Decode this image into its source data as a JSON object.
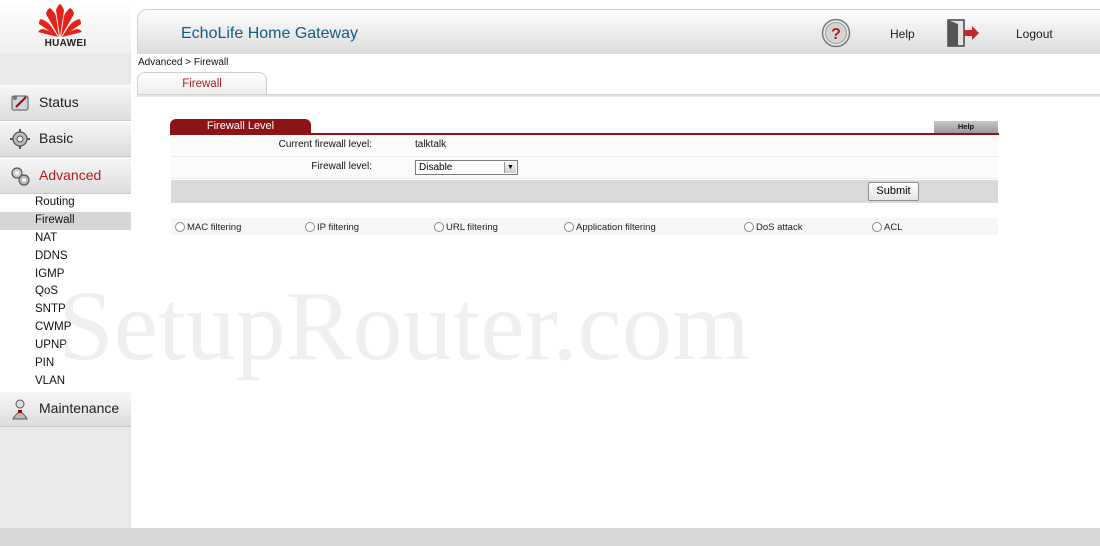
{
  "brand": {
    "name": "HUAWEI",
    "logo_color": "#e2231a"
  },
  "header": {
    "app_title": "EchoLife Home Gateway",
    "help_label": "Help",
    "logout_label": "Logout",
    "help_icon": "question-icon",
    "logout_icon": "logout-door-icon"
  },
  "breadcrumb": "Advanced > Firewall",
  "tab": {
    "label": "Firewall"
  },
  "sidebar": {
    "sections": [
      {
        "label": "Status",
        "icon": "status-icon"
      },
      {
        "label": "Basic",
        "icon": "basic-icon"
      },
      {
        "label": "Advanced",
        "icon": "advanced-icon",
        "active": true
      },
      {
        "label": "Maintenance",
        "icon": "maintenance-icon"
      }
    ],
    "advanced_items": [
      "Routing",
      "Firewall",
      "NAT",
      "DDNS",
      "IGMP",
      "QoS",
      "SNTP",
      "CWMP",
      "UPNP",
      "PIN",
      "VLAN"
    ],
    "current_item": "Firewall"
  },
  "panel": {
    "title": "Firewall Level",
    "help_label": "Help",
    "current_level_label": "Current firewall level:",
    "current_level_value": "talktalk",
    "level_label": "Firewall level:",
    "level_selected": "Disable",
    "submit_label": "Submit"
  },
  "filters": [
    "MAC filtering",
    "IP filtering",
    "URL filtering",
    "Application filtering",
    "DoS attack",
    "ACL"
  ],
  "watermark": "SetupRouter.com",
  "colors": {
    "accent_red": "#8c1417",
    "title_blue": "#0f5e86",
    "active_text": "#b21d20"
  }
}
